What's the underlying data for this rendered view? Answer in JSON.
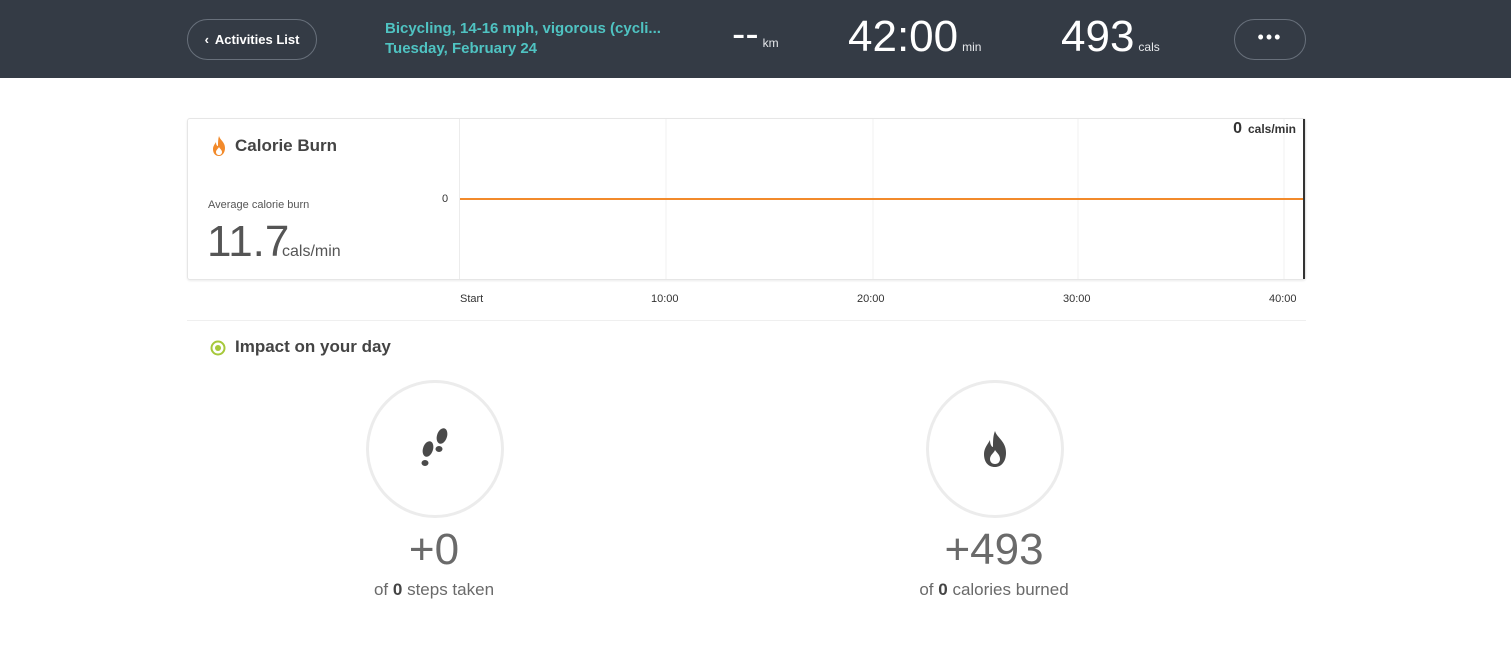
{
  "header": {
    "back_label": "Activities List",
    "activity_title": "Bicycling, 14-16 mph, vigorous (cycli...",
    "activity_date": "Tuesday, February 24",
    "distance_value": "--",
    "distance_unit": "km",
    "duration_value": "42:00",
    "duration_unit": "min",
    "calories_value": "493",
    "calories_unit": "cals",
    "more_label": "•••"
  },
  "calorie_burn": {
    "title": "Calorie Burn",
    "avg_label": "Average calorie burn",
    "avg_value": "11.7",
    "avg_unit": "cals/min",
    "readout_value": "0",
    "readout_unit": "cals/min"
  },
  "chart_data": {
    "type": "line",
    "title": "Calorie Burn",
    "xlabel": "",
    "ylabel": "",
    "x_ticks": [
      "Start",
      "10:00",
      "20:00",
      "30:00",
      "40:00"
    ],
    "y_ticks": [
      "0"
    ],
    "x": [
      0,
      42
    ],
    "series": [
      {
        "values": [
          0,
          0
        ]
      }
    ],
    "xlim": [
      0,
      42
    ],
    "grid": true,
    "line_color": "#f28a2b"
  },
  "impact": {
    "title": "Impact on your day",
    "steps_value": "+0",
    "steps_prefix": "of",
    "steps_count": "0",
    "steps_suffix": "steps taken",
    "cals_value": "+493",
    "cals_prefix": "of",
    "cals_count": "0",
    "cals_suffix": "calories burned"
  },
  "colors": {
    "header_bg": "#343b45",
    "accent_teal": "#4fc3c2",
    "flame_orange": "#f28a2b",
    "impact_green": "#a6c83a"
  }
}
